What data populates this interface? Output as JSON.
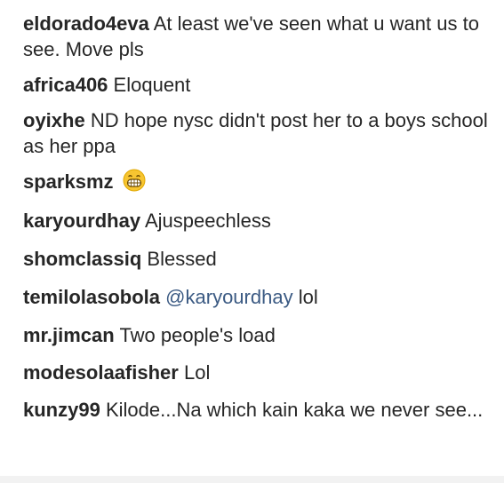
{
  "comments": [
    {
      "username": "eldorado4eva",
      "text": "At least we've seen what u want us to see. Move pls"
    },
    {
      "username": "africa406",
      "text": "Eloquent"
    },
    {
      "username": "oyixhe",
      "text": "ND hope nysc didn't post her to a boys school as her ppa"
    },
    {
      "username": "sparksmz",
      "text": "",
      "emoji": "grinning-face-icon"
    },
    {
      "username": "karyourdhay",
      "text": "Ajuspeechless"
    },
    {
      "username": "shomclassiq",
      "text": "Blessed"
    },
    {
      "username": "temilolasobola",
      "mention": "@karyourdhay",
      "text": "lol"
    },
    {
      "username": "mr.jimcan",
      "text": "Two people's load"
    },
    {
      "username": "modesolaafisher",
      "text": "Lol"
    },
    {
      "username": "kunzy99",
      "text": "Kilode...Na which kain kaka we never see..."
    }
  ],
  "colors": {
    "text": "#262626",
    "mention": "#3b5a83",
    "emoji_face": "#f7c531"
  }
}
